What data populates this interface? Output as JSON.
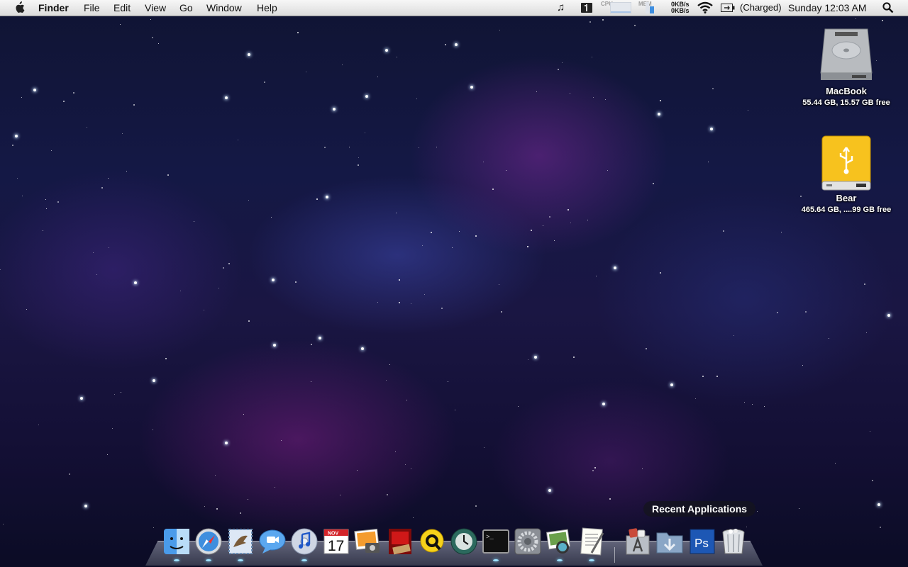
{
  "menubar": {
    "app_name": "Finder",
    "menus": [
      "File",
      "Edit",
      "View",
      "Go",
      "Window",
      "Help"
    ],
    "status": {
      "cpu_label": "CPU",
      "mem_label": "MEM",
      "net_up": "0KB/s",
      "net_down": "0KB/s",
      "battery": "(Charged)",
      "clock": "Sunday 12:03 AM"
    },
    "icons": [
      "apple-logo-icon",
      "itunes-note-icon",
      "book-icon",
      "cpu-meter-icon",
      "memory-meter-icon",
      "wifi-icon",
      "battery-icon",
      "spotlight-icon"
    ]
  },
  "desktop": {
    "icons": [
      {
        "name": "MacBook",
        "info": "55.44 GB, 15.57 GB free",
        "icon": "hard-drive-icon"
      },
      {
        "name": "Bear",
        "info": "465.64 GB, ....99 GB free",
        "icon": "usb-drive-icon"
      }
    ]
  },
  "dock": {
    "tooltip": "Recent Applications",
    "apps": [
      {
        "name": "Finder",
        "icon": "finder-icon"
      },
      {
        "name": "Safari",
        "icon": "safari-icon"
      },
      {
        "name": "Mail",
        "icon": "mail-icon"
      },
      {
        "name": "iChat",
        "icon": "ichat-icon"
      },
      {
        "name": "iTunes",
        "icon": "itunes-icon"
      },
      {
        "name": "iCal",
        "icon": "ical-icon",
        "calendar_month": "NOV",
        "calendar_day": "17"
      },
      {
        "name": "iPhoto",
        "icon": "iphoto-icon"
      },
      {
        "name": "Front Row",
        "icon": "front-row-icon"
      },
      {
        "name": "QuickTime",
        "icon": "quicktime-icon"
      },
      {
        "name": "Time Machine",
        "icon": "time-machine-icon"
      },
      {
        "name": "Terminal",
        "icon": "terminal-icon",
        "prompt": ">_"
      },
      {
        "name": "System Preferences",
        "icon": "system-preferences-icon"
      },
      {
        "name": "Preview",
        "icon": "preview-icon"
      },
      {
        "name": "TextEdit",
        "icon": "textedit-icon"
      },
      {
        "name": "Applications",
        "icon": "applications-stack-icon"
      },
      {
        "name": "Downloads",
        "icon": "downloads-stack-icon"
      },
      {
        "name": "Photoshop",
        "icon": "photoshop-icon",
        "label": "Ps"
      },
      {
        "name": "Trash",
        "icon": "trash-icon"
      }
    ]
  }
}
